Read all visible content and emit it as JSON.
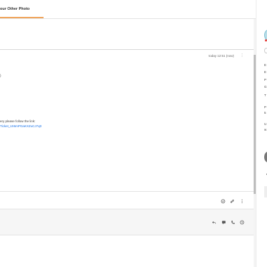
{
  "tabs": {
    "active_label": "our Other Photo"
  },
  "message": {
    "time": "today 12:51 (now)",
    "more": "⋮",
    "paren": ")",
    "line1": "ery please follow the link:",
    "link": "Ticket_sX6mPGaKXZuCJ7q0"
  },
  "sidebar": {
    "labels": [
      "E",
      "E",
      "P",
      "G",
      "T",
      "P",
      "5",
      "U",
      "w"
    ]
  }
}
